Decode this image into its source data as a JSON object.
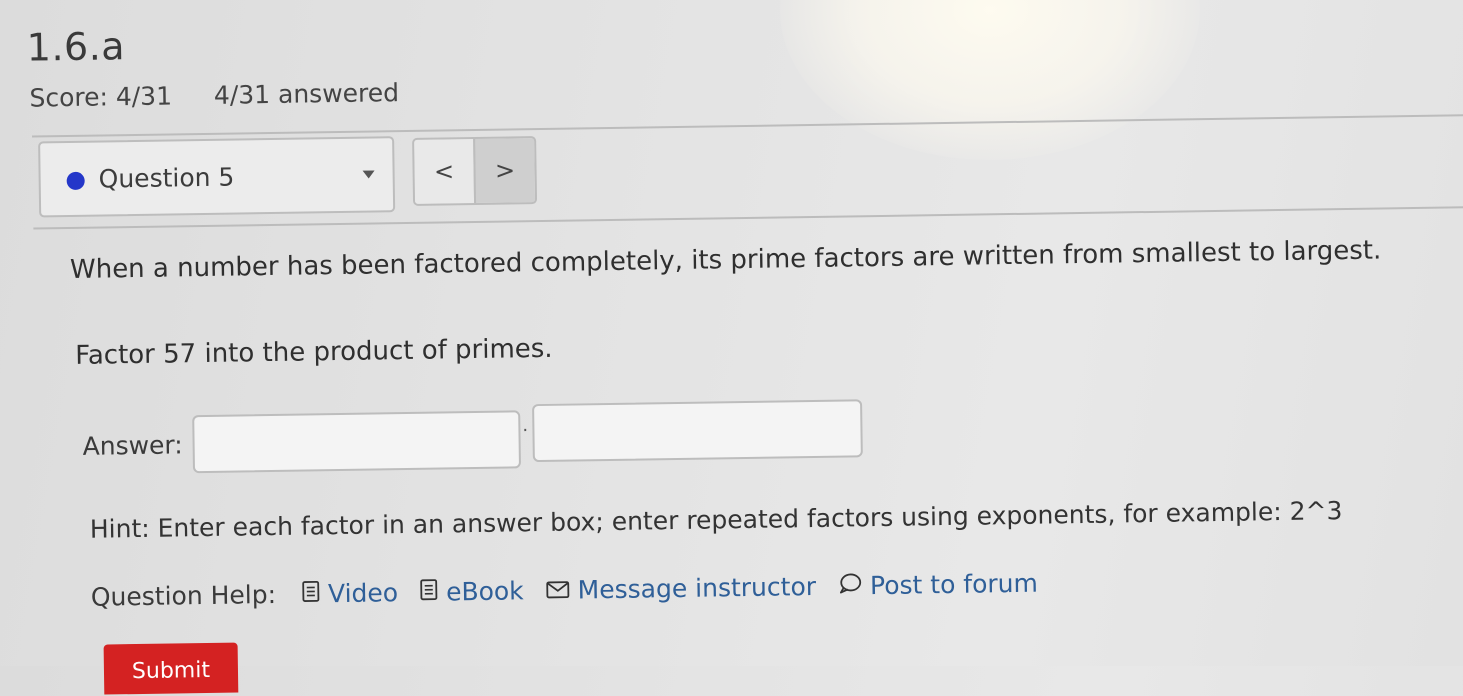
{
  "page": {
    "title": "1.6.a",
    "score": "Score: 4/31",
    "answered": "4/31 answered"
  },
  "question_nav": {
    "selected": "Question 5",
    "prev_symbol": "<",
    "next_symbol": ">"
  },
  "question": {
    "instruction": "When a number has been factored completely, its prime factors are written from smallest to largest.",
    "prompt": "Factor 57 into the product of primes.",
    "answer_label": "Answer:",
    "answer_values": [
      "",
      ""
    ],
    "multiply_symbol": "·",
    "hint": "Hint: Enter each factor in an answer box; enter repeated factors using exponents, for example: 2^3"
  },
  "help": {
    "label": "Question Help:",
    "links": [
      {
        "label": "Video",
        "icon": "document-icon"
      },
      {
        "label": "eBook",
        "icon": "document-icon"
      },
      {
        "label": "Message instructor",
        "icon": "envelope-icon"
      },
      {
        "label": "Post to forum",
        "icon": "speech-bubble-icon"
      }
    ]
  },
  "actions": {
    "submit_label": "Submit"
  },
  "colors": {
    "accent_dot": "#2437c9",
    "link": "#2f5f98",
    "submit": "#d42222"
  }
}
